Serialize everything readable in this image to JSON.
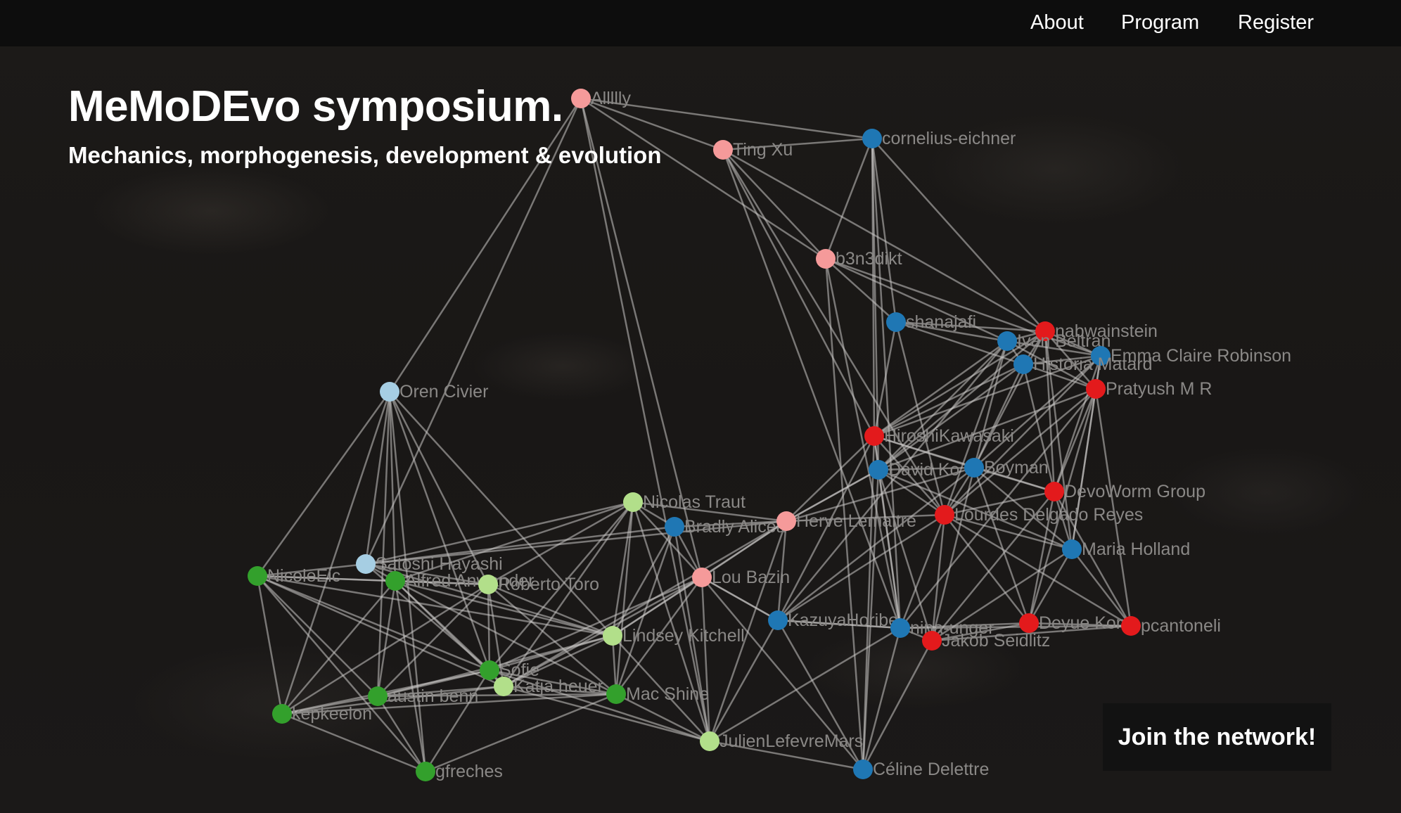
{
  "nav": {
    "links": [
      {
        "label": "About"
      },
      {
        "label": "Program"
      },
      {
        "label": "Register"
      }
    ]
  },
  "hero": {
    "title": "MeMoDEvo symposium.",
    "subtitle": "Mechanics, morphogenesis, development & evolution"
  },
  "cta": {
    "label": "Join the network!"
  },
  "colors": {
    "pink": "#f59a9a",
    "blue": "#1f77b4",
    "red": "#e31a1c",
    "lightblue": "#a6cee3",
    "green": "#33a02c",
    "lightgreen": "#b2df8a",
    "edge": "#c8c6c4"
  },
  "network": {
    "nodes": [
      {
        "id": "alllly",
        "label": "Allllly",
        "group": "pink"
      },
      {
        "id": "tingxu",
        "label": "Ting Xu",
        "group": "pink"
      },
      {
        "id": "cornelius",
        "label": "cornelius-eichner",
        "group": "blue"
      },
      {
        "id": "b3n3dikt",
        "label": "b3n3dikt",
        "group": "pink"
      },
      {
        "id": "shanajafi",
        "label": "shanajafi",
        "group": "blue"
      },
      {
        "id": "nabwainstein",
        "label": "nabwainstein",
        "group": "red"
      },
      {
        "id": "ivanbeltran",
        "label": "Ivan Beltran",
        "group": "blue"
      },
      {
        "id": "emma",
        "label": "Emma Claire Robinson",
        "group": "blue"
      },
      {
        "id": "historia",
        "label": "Historia Matard",
        "group": "blue"
      },
      {
        "id": "pratyush",
        "label": "Pratyush M R",
        "group": "red"
      },
      {
        "id": "oren",
        "label": "Oren Civier",
        "group": "lightblue"
      },
      {
        "id": "hiroshi",
        "label": "HiroshiKawasaki",
        "group": "red"
      },
      {
        "id": "davidk",
        "label": "David Ko",
        "group": "blue"
      },
      {
        "id": "boyman",
        "label": "Boyman",
        "group": "blue"
      },
      {
        "id": "devoworm",
        "label": "DevoWorm Group",
        "group": "red"
      },
      {
        "id": "lourdes",
        "label": "Lourdes Delgado Reyes",
        "group": "red"
      },
      {
        "id": "nicolas",
        "label": "Nicolas Traut",
        "group": "lightgreen"
      },
      {
        "id": "bradly",
        "label": "Bradly Alicea",
        "group": "blue"
      },
      {
        "id": "herve",
        "label": "Herve Lemaitre",
        "group": "pink"
      },
      {
        "id": "maria",
        "label": "Maria Holland",
        "group": "blue"
      },
      {
        "id": "satoshi",
        "label": "Satoshi Hayashi",
        "group": "lightblue"
      },
      {
        "id": "nicole",
        "label": "NicoleEic",
        "group": "green"
      },
      {
        "id": "alfred",
        "label": "Alfred Anwander",
        "group": "green"
      },
      {
        "id": "roberto",
        "label": "Roberto Toro",
        "group": "lightgreen"
      },
      {
        "id": "lou",
        "label": "Lou Bazin",
        "group": "pink"
      },
      {
        "id": "kazuya",
        "label": "KazuyaHoribe",
        "group": "blue"
      },
      {
        "id": "nina",
        "label": "nina-unger",
        "group": "blue"
      },
      {
        "id": "jakob",
        "label": "Jakob Seidlitz",
        "group": "red"
      },
      {
        "id": "deyue",
        "label": "Deyue Kong",
        "group": "red"
      },
      {
        "id": "pcantoneli",
        "label": "pcantoneli",
        "group": "red"
      },
      {
        "id": "lindsey",
        "label": "Lindsey Kitchell",
        "group": "lightgreen"
      },
      {
        "id": "sofie",
        "label": "Sofie",
        "group": "green"
      },
      {
        "id": "katja",
        "label": "Katja heuer",
        "group": "lightgreen"
      },
      {
        "id": "macshine",
        "label": "Mac Shine",
        "group": "green"
      },
      {
        "id": "austin",
        "label": "austin benn",
        "group": "green"
      },
      {
        "id": "kepkee",
        "label": "kepkeelon",
        "group": "green"
      },
      {
        "id": "julien",
        "label": "JulienLefevreMars",
        "group": "lightgreen"
      },
      {
        "id": "celine",
        "label": "Céline Delettre",
        "group": "blue"
      },
      {
        "id": "gfreches",
        "label": "gfreches",
        "group": "green"
      }
    ],
    "edges": [
      [
        "alllly",
        "tingxu"
      ],
      [
        "alllly",
        "cornelius"
      ],
      [
        "alllly",
        "oren"
      ],
      [
        "alllly",
        "b3n3dikt"
      ],
      [
        "alllly",
        "julien"
      ],
      [
        "alllly",
        "satoshi"
      ],
      [
        "alllly",
        "lou"
      ],
      [
        "tingxu",
        "cornelius"
      ],
      [
        "tingxu",
        "b3n3dikt"
      ],
      [
        "tingxu",
        "nabwainstein"
      ],
      [
        "tingxu",
        "hiroshi"
      ],
      [
        "tingxu",
        "lourdes"
      ],
      [
        "tingxu",
        "nina"
      ],
      [
        "cornelius",
        "shanajafi"
      ],
      [
        "cornelius",
        "nabwainstein"
      ],
      [
        "cornelius",
        "hiroshi"
      ],
      [
        "cornelius",
        "davidk"
      ],
      [
        "cornelius",
        "nina"
      ],
      [
        "cornelius",
        "b3n3dikt"
      ],
      [
        "b3n3dikt",
        "shanajafi"
      ],
      [
        "b3n3dikt",
        "ivanbeltran"
      ],
      [
        "b3n3dikt",
        "nina"
      ],
      [
        "b3n3dikt",
        "celine"
      ],
      [
        "b3n3dikt",
        "emma"
      ],
      [
        "shanajafi",
        "nabwainstein"
      ],
      [
        "shanajafi",
        "ivanbeltran"
      ],
      [
        "shanajafi",
        "hiroshi"
      ],
      [
        "shanajafi",
        "lourdes"
      ],
      [
        "shanajafi",
        "historia"
      ],
      [
        "nabwainstein",
        "ivanbeltran"
      ],
      [
        "nabwainstein",
        "emma"
      ],
      [
        "nabwainstein",
        "historia"
      ],
      [
        "nabwainstein",
        "pratyush"
      ],
      [
        "nabwainstein",
        "hiroshi"
      ],
      [
        "nabwainstein",
        "davidk"
      ],
      [
        "nabwainstein",
        "boyman"
      ],
      [
        "nabwainstein",
        "devoworm"
      ],
      [
        "nabwainstein",
        "maria"
      ],
      [
        "ivanbeltran",
        "emma"
      ],
      [
        "ivanbeltran",
        "historia"
      ],
      [
        "ivanbeltran",
        "pratyush"
      ],
      [
        "ivanbeltran",
        "hiroshi"
      ],
      [
        "ivanbeltran",
        "davidk"
      ],
      [
        "ivanbeltran",
        "boyman"
      ],
      [
        "ivanbeltran",
        "lourdes"
      ],
      [
        "ivanbeltran",
        "kazuya"
      ],
      [
        "emma",
        "historia"
      ],
      [
        "emma",
        "pratyush"
      ],
      [
        "emma",
        "hiroshi"
      ],
      [
        "emma",
        "boyman"
      ],
      [
        "emma",
        "devoworm"
      ],
      [
        "emma",
        "lourdes"
      ],
      [
        "emma",
        "maria"
      ],
      [
        "historia",
        "pratyush"
      ],
      [
        "historia",
        "davidk"
      ],
      [
        "historia",
        "boyman"
      ],
      [
        "historia",
        "devoworm"
      ],
      [
        "historia",
        "hiroshi"
      ],
      [
        "pratyush",
        "devoworm"
      ],
      [
        "pratyush",
        "lourdes"
      ],
      [
        "pratyush",
        "maria"
      ],
      [
        "pratyush",
        "pcantoneli"
      ],
      [
        "pratyush",
        "deyue"
      ],
      [
        "pratyush",
        "davidk"
      ],
      [
        "pratyush",
        "nina"
      ],
      [
        "oren",
        "satoshi"
      ],
      [
        "oren",
        "nicole"
      ],
      [
        "oren",
        "alfred"
      ],
      [
        "oren",
        "roberto"
      ],
      [
        "oren",
        "sofie"
      ],
      [
        "oren",
        "austin"
      ],
      [
        "oren",
        "kepkee"
      ],
      [
        "oren",
        "gfreches"
      ],
      [
        "oren",
        "lindsey"
      ],
      [
        "hiroshi",
        "davidk"
      ],
      [
        "hiroshi",
        "boyman"
      ],
      [
        "hiroshi",
        "lourdes"
      ],
      [
        "hiroshi",
        "devoworm"
      ],
      [
        "hiroshi",
        "nina"
      ],
      [
        "hiroshi",
        "celine"
      ],
      [
        "hiroshi",
        "kazuya"
      ],
      [
        "hiroshi",
        "herve"
      ],
      [
        "davidk",
        "boyman"
      ],
      [
        "davidk",
        "lourdes"
      ],
      [
        "davidk",
        "maria"
      ],
      [
        "davidk",
        "jakob"
      ],
      [
        "davidk",
        "celine"
      ],
      [
        "davidk",
        "nina"
      ],
      [
        "davidk",
        "herve"
      ],
      [
        "boyman",
        "lourdes"
      ],
      [
        "boyman",
        "devoworm"
      ],
      [
        "boyman",
        "maria"
      ],
      [
        "boyman",
        "jakob"
      ],
      [
        "boyman",
        "deyue"
      ],
      [
        "boyman",
        "kazuya"
      ],
      [
        "devoworm",
        "lourdes"
      ],
      [
        "devoworm",
        "maria"
      ],
      [
        "devoworm",
        "deyue"
      ],
      [
        "devoworm",
        "jakob"
      ],
      [
        "devoworm",
        "pcantoneli"
      ],
      [
        "lourdes",
        "maria"
      ],
      [
        "lourdes",
        "jakob"
      ],
      [
        "lourdes",
        "deyue"
      ],
      [
        "lourdes",
        "pcantoneli"
      ],
      [
        "lourdes",
        "nina"
      ],
      [
        "lourdes",
        "kazuya"
      ],
      [
        "lourdes",
        "herve"
      ],
      [
        "maria",
        "pcantoneli"
      ],
      [
        "maria",
        "deyue"
      ],
      [
        "maria",
        "jakob"
      ],
      [
        "nina",
        "jakob"
      ],
      [
        "nina",
        "deyue"
      ],
      [
        "nina",
        "pcantoneli"
      ],
      [
        "nina",
        "kazuya"
      ],
      [
        "nina",
        "celine"
      ],
      [
        "jakob",
        "deyue"
      ],
      [
        "jakob",
        "pcantoneli"
      ],
      [
        "deyue",
        "pcantoneli"
      ],
      [
        "kazuya",
        "celine"
      ],
      [
        "kazuya",
        "julien"
      ],
      [
        "kazuya",
        "herve"
      ],
      [
        "kazuya",
        "lou"
      ],
      [
        "kazuya",
        "nina"
      ],
      [
        "nicolas",
        "bradly"
      ],
      [
        "nicolas",
        "herve"
      ],
      [
        "nicolas",
        "lou"
      ],
      [
        "nicolas",
        "lindsey"
      ],
      [
        "nicolas",
        "macshine"
      ],
      [
        "nicolas",
        "julien"
      ],
      [
        "nicolas",
        "sofie"
      ],
      [
        "nicolas",
        "roberto"
      ],
      [
        "nicolas",
        "katja"
      ],
      [
        "nicolas",
        "alfred"
      ],
      [
        "bradly",
        "herve"
      ],
      [
        "bradly",
        "lou"
      ],
      [
        "bradly",
        "lindsey"
      ],
      [
        "bradly",
        "julien"
      ],
      [
        "bradly",
        "macshine"
      ],
      [
        "herve",
        "lou"
      ],
      [
        "herve",
        "lindsey"
      ],
      [
        "herve",
        "julien"
      ],
      [
        "herve",
        "davidk"
      ],
      [
        "herve",
        "boyman"
      ],
      [
        "herve",
        "katja"
      ],
      [
        "herve",
        "satoshi"
      ],
      [
        "lou",
        "lindsey"
      ],
      [
        "lou",
        "julien"
      ],
      [
        "lou",
        "macshine"
      ],
      [
        "lou",
        "katja"
      ],
      [
        "lou",
        "sofie"
      ],
      [
        "lou",
        "kazuya"
      ],
      [
        "satoshi",
        "alfred"
      ],
      [
        "satoshi",
        "roberto"
      ],
      [
        "satoshi",
        "nicole"
      ],
      [
        "satoshi",
        "sofie"
      ],
      [
        "satoshi",
        "lindsey"
      ],
      [
        "satoshi",
        "nicolas"
      ],
      [
        "satoshi",
        "bradly"
      ],
      [
        "nicole",
        "alfred"
      ],
      [
        "nicole",
        "roberto"
      ],
      [
        "nicole",
        "kepkee"
      ],
      [
        "nicole",
        "austin"
      ],
      [
        "nicole",
        "sofie"
      ],
      [
        "nicole",
        "gfreches"
      ],
      [
        "nicole",
        "katja"
      ],
      [
        "nicole",
        "lindsey"
      ],
      [
        "alfred",
        "roberto"
      ],
      [
        "alfred",
        "sofie"
      ],
      [
        "alfred",
        "austin"
      ],
      [
        "alfred",
        "kepkee"
      ],
      [
        "alfred",
        "gfreches"
      ],
      [
        "alfred",
        "katja"
      ],
      [
        "alfred",
        "macshine"
      ],
      [
        "alfred",
        "lindsey"
      ],
      [
        "roberto",
        "sofie"
      ],
      [
        "roberto",
        "lindsey"
      ],
      [
        "roberto",
        "katja"
      ],
      [
        "roberto",
        "macshine"
      ],
      [
        "roberto",
        "kepkee"
      ],
      [
        "roberto",
        "austin"
      ],
      [
        "lindsey",
        "sofie"
      ],
      [
        "lindsey",
        "katja"
      ],
      [
        "lindsey",
        "macshine"
      ],
      [
        "lindsey",
        "julien"
      ],
      [
        "lindsey",
        "austin"
      ],
      [
        "sofie",
        "katja"
      ],
      [
        "sofie",
        "austin"
      ],
      [
        "sofie",
        "kepkee"
      ],
      [
        "sofie",
        "gfreches"
      ],
      [
        "sofie",
        "macshine"
      ],
      [
        "sofie",
        "julien"
      ],
      [
        "katja",
        "austin"
      ],
      [
        "katja",
        "macshine"
      ],
      [
        "katja",
        "kepkee"
      ],
      [
        "katja",
        "julien"
      ],
      [
        "macshine",
        "austin"
      ],
      [
        "macshine",
        "julien"
      ],
      [
        "macshine",
        "kepkee"
      ],
      [
        "macshine",
        "gfreches"
      ],
      [
        "austin",
        "kepkee"
      ],
      [
        "austin",
        "gfreches"
      ],
      [
        "kepkee",
        "gfreches"
      ],
      [
        "julien",
        "celine"
      ],
      [
        "julien",
        "nina"
      ],
      [
        "celine",
        "jakob"
      ],
      [
        "celine",
        "lou"
      ]
    ]
  }
}
